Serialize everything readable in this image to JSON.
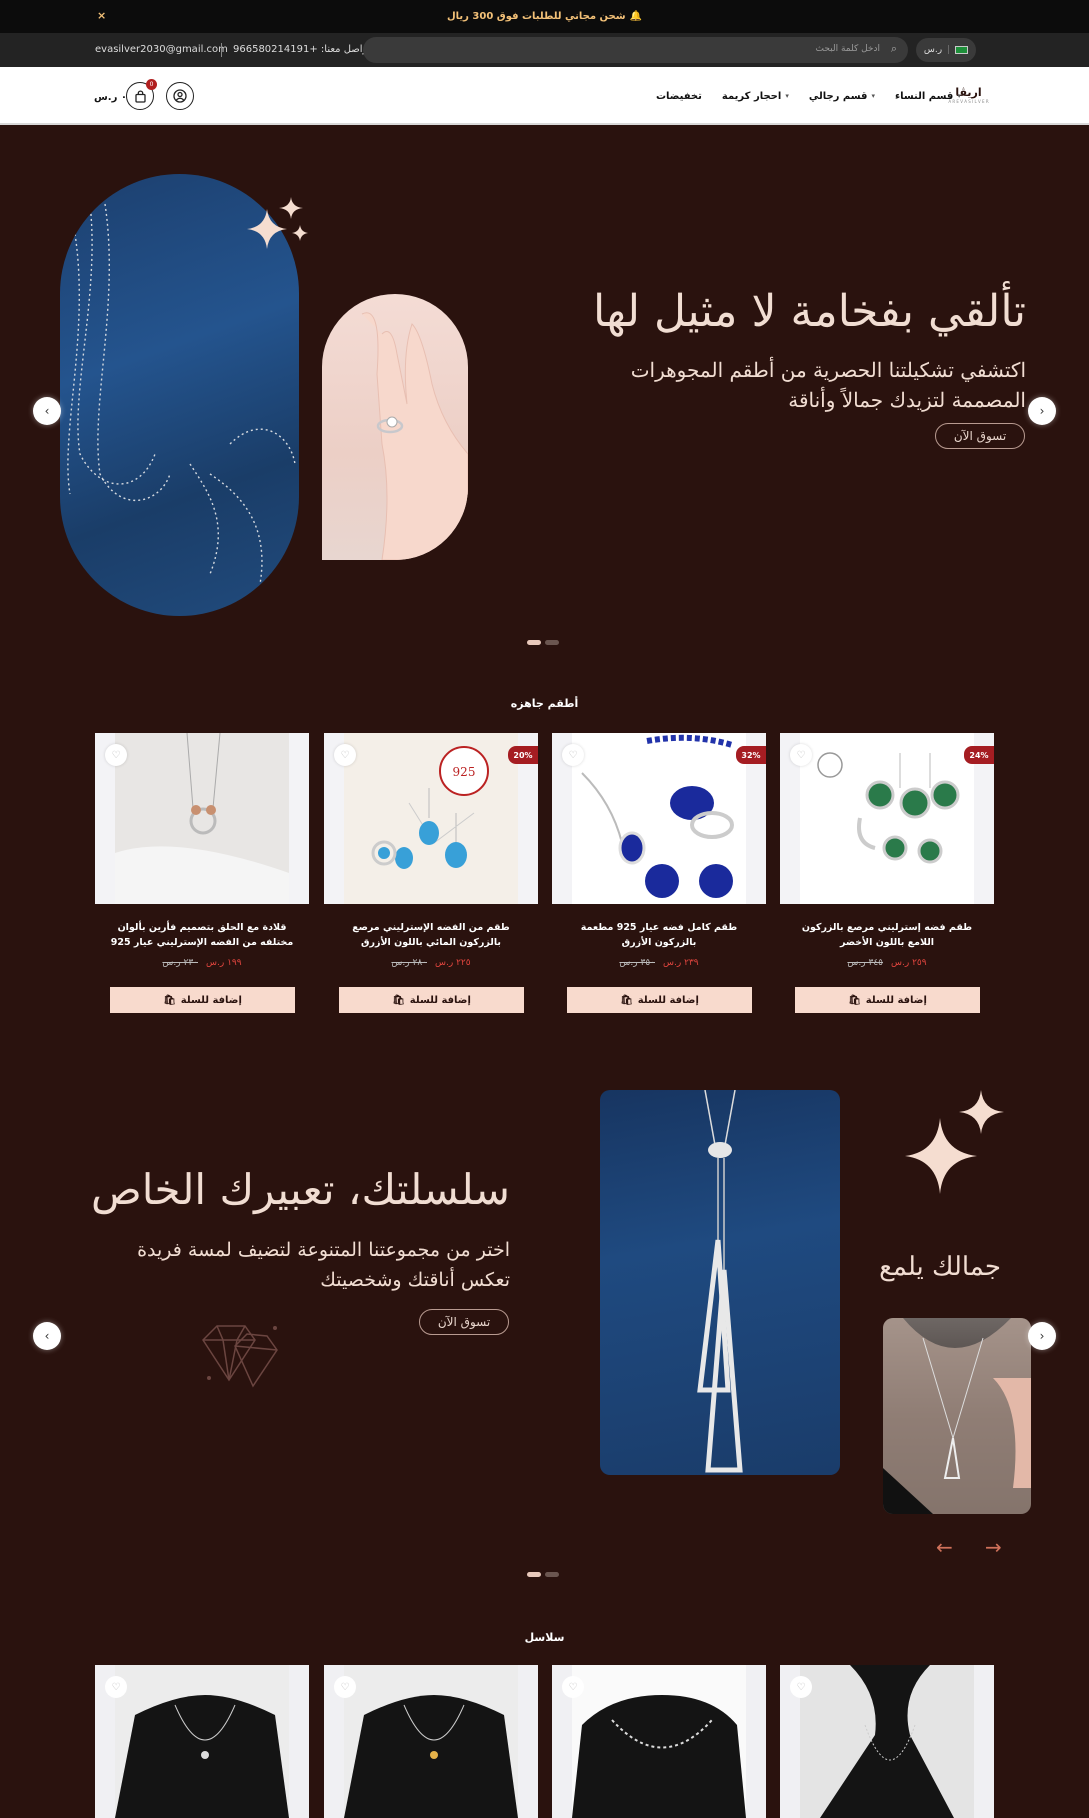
{
  "announcement": {
    "text": "شحن مجاني للطلبات فوق 300 ريال",
    "close": "×"
  },
  "utility": {
    "email": "evasilver2030@gmail.com",
    "phone": "تواصل معنا: +966580214191",
    "search_placeholder": "ادخل كلمة البحث",
    "currency": "ر.س"
  },
  "nav": {
    "logo": "اريڤا",
    "logo_sub": "A R E V A S I L V E R",
    "items": [
      {
        "label": "قسم النساء",
        "dropdown": true
      },
      {
        "label": "قسم رجالي",
        "dropdown": true
      },
      {
        "label": "احجار كريمة",
        "dropdown": true
      },
      {
        "label": "تخفيضات",
        "dropdown": false
      }
    ],
    "cart_count": "0",
    "cart_total": "٠ ر.س"
  },
  "hero": {
    "title": "تألقي بفخامة لا مثيل لها",
    "subtitle_line1": "اكتشفي تشكيلتنا الحصرية من أطقم المجوهرات",
    "subtitle_line2": "المصممة لتزيدك جمالاً وأناقة",
    "button": "تسوق الآن"
  },
  "products_section": {
    "title": "أطقم جاهزه",
    "add_label": "إضافة للسلة",
    "items": [
      {
        "name": "طقم فضه إسترليني مرصع بالزركون اللامع باللون الأخضر",
        "price": "٢٥٩ ر.س",
        "old_price": "٣٤٥ ر.س",
        "discount": "24%"
      },
      {
        "name": "طقم كامل فضه عيار 925 مطعمة بالزركون الأزرق",
        "price": "٢٣٩ ر.س",
        "old_price": "٣٥٠ ر.س",
        "discount": "32%"
      },
      {
        "name": "طقم من الفضه الإسترليني مرصع بالزركون المائي باللون الأزرق",
        "price": "٢٢٥ ر.س",
        "old_price": "٢٨٠ ر.س",
        "discount": "20%"
      },
      {
        "name": "قلادة مع الحلق بتصميم فأرين بألوان مختلفه من الفضه الإسترليني عيار 925",
        "price": "١٩٩ ر.س",
        "old_price": "٢٣٠ ر.س",
        "discount": ""
      }
    ]
  },
  "banner2": {
    "title": "سلسلتك، تعبيرك الخاص",
    "subtitle_line1": "اختر من مجموعتنا المتنوعة لتضيف لمسة فريدة",
    "subtitle_line2": "تعكس أناقتك وشخصيتك",
    "button": "تسوق الآن",
    "side_text": "جمالك يلمع"
  },
  "chains_section": {
    "title": "سلاسل"
  },
  "colors": {
    "background": "#2a120e",
    "accent": "#f8dacd",
    "price": "#e0453e",
    "discount": "#a51d22"
  }
}
